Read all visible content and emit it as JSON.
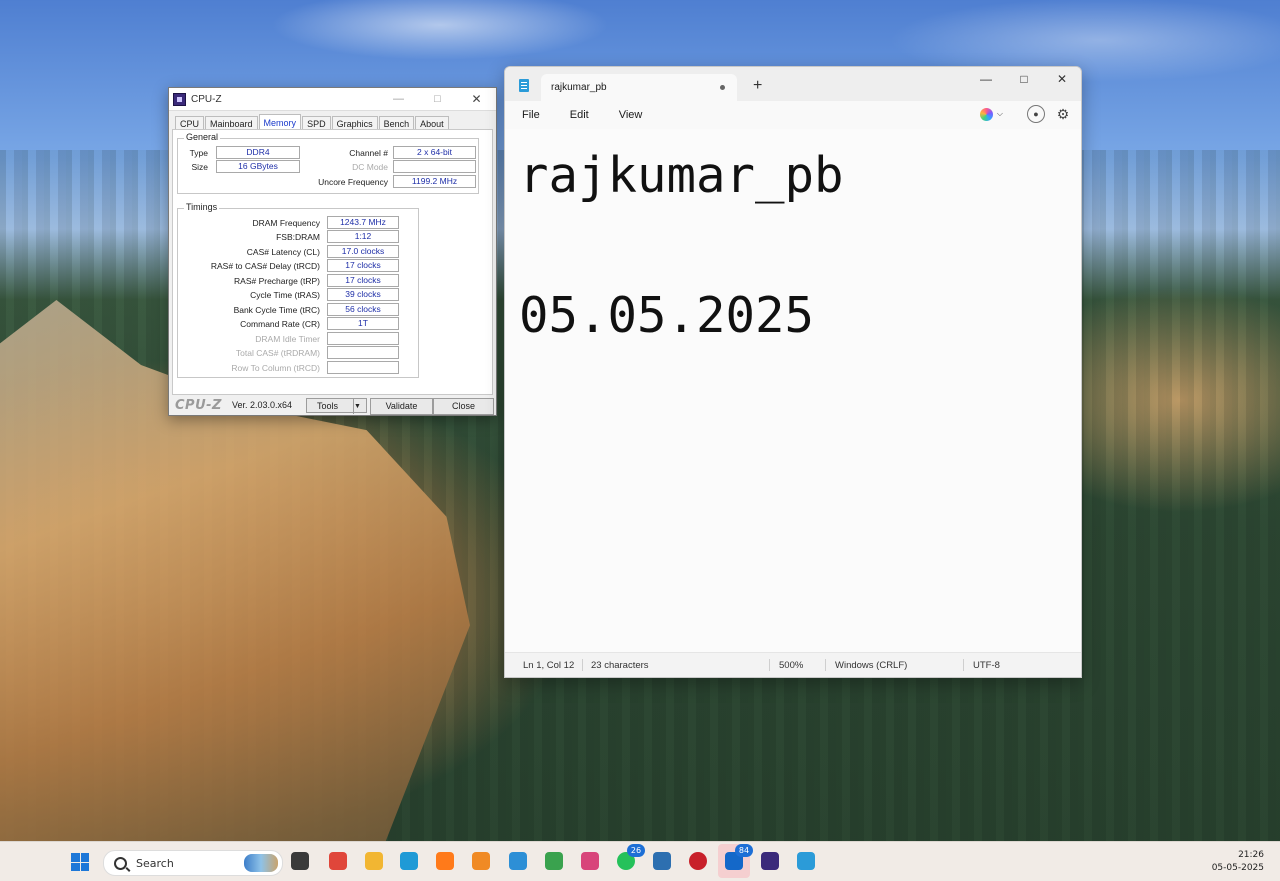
{
  "cpuz": {
    "title": "CPU-Z",
    "tabs": [
      "CPU",
      "Mainboard",
      "Memory",
      "SPD",
      "Graphics",
      "Bench",
      "About"
    ],
    "active_tab": "Memory",
    "general": {
      "legend": "General",
      "type_label": "Type",
      "type_value": "DDR4",
      "size_label": "Size",
      "size_value": "16 GBytes",
      "channel_label": "Channel #",
      "channel_value": "2 x 64-bit",
      "dcmode_label": "DC Mode",
      "dcmode_value": "",
      "uncore_label": "Uncore Frequency",
      "uncore_value": "1199.2 MHz"
    },
    "timings": {
      "legend": "Timings",
      "rows": [
        {
          "label": "DRAM Frequency",
          "value": "1243.7 MHz",
          "dim": false
        },
        {
          "label": "FSB:DRAM",
          "value": "1:12",
          "dim": false
        },
        {
          "label": "CAS# Latency (CL)",
          "value": "17.0 clocks",
          "dim": false
        },
        {
          "label": "RAS# to CAS# Delay (tRCD)",
          "value": "17 clocks",
          "dim": false
        },
        {
          "label": "RAS# Precharge (tRP)",
          "value": "17 clocks",
          "dim": false
        },
        {
          "label": "Cycle Time (tRAS)",
          "value": "39 clocks",
          "dim": false
        },
        {
          "label": "Bank Cycle Time (tRC)",
          "value": "56 clocks",
          "dim": false
        },
        {
          "label": "Command Rate (CR)",
          "value": "1T",
          "dim": false
        },
        {
          "label": "DRAM Idle Timer",
          "value": "",
          "dim": true
        },
        {
          "label": "Total CAS# (tRDRAM)",
          "value": "",
          "dim": true
        },
        {
          "label": "Row To Column (tRCD)",
          "value": "",
          "dim": true
        }
      ]
    },
    "footer": {
      "brand": "CPU-Z",
      "version": "Ver. 2.03.0.x64",
      "tools_label": "Tools",
      "validate_label": "Validate",
      "close_label": "Close"
    }
  },
  "notepad": {
    "tab_title": "rajkumar_pb",
    "new_tab": "+",
    "menu": [
      "File",
      "Edit",
      "View"
    ],
    "content_lines": [
      "rajkumar_pb",
      "",
      "05.05.2025"
    ],
    "status": {
      "position": "Ln 1, Col 12",
      "characters": "23 characters",
      "zoom": "500%",
      "line_ending": "Windows (CRLF)",
      "encoding": "UTF-8"
    }
  },
  "taskbar": {
    "search_text": "Search",
    "apps": [
      {
        "name": "task-view-icon",
        "color": "#3a3a3a"
      },
      {
        "name": "chrome-icon",
        "color": "#e0463a"
      },
      {
        "name": "file-explorer-icon",
        "color": "#f2b632"
      },
      {
        "name": "edge-icon",
        "color": "#1f9ad6"
      },
      {
        "name": "firefox-icon",
        "color": "#ff7a1a"
      },
      {
        "name": "sublime-icon",
        "color": "#f08a24"
      },
      {
        "name": "photos-icon",
        "color": "#2d8fd6"
      },
      {
        "name": "notepad-pen-icon",
        "color": "#3aa24e"
      },
      {
        "name": "snipping-tool-icon",
        "color": "#d8457a"
      },
      {
        "name": "whatsapp-icon",
        "color": "#25c15a",
        "badge": "26"
      },
      {
        "name": "terminal-icon",
        "color": "#2d6fb0"
      },
      {
        "name": "red-app-icon",
        "color": "#c8202a"
      },
      {
        "name": "outlook-icon",
        "color": "#1468c9",
        "badge": "84"
      },
      {
        "name": "cpuz-icon",
        "color": "#3b2a7a"
      },
      {
        "name": "notepad-icon",
        "color": "#2b9bd8"
      }
    ],
    "clock_time": "21:26",
    "clock_date": "05-05-2025"
  }
}
